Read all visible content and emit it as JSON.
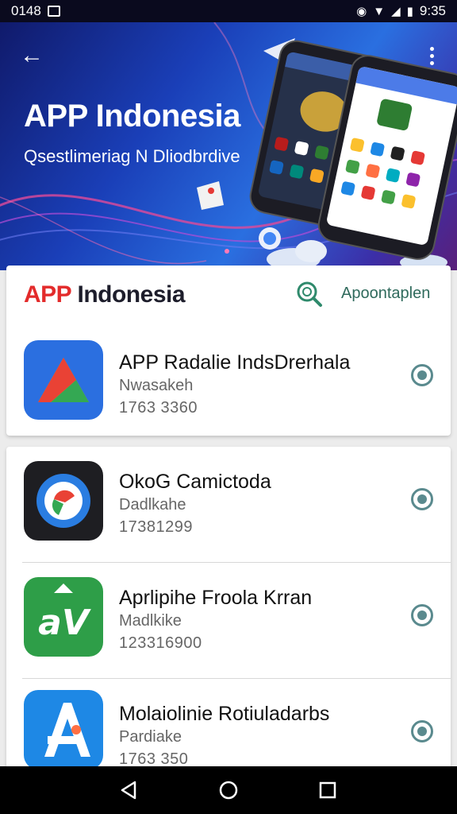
{
  "status_bar": {
    "left_time": "0148",
    "right_time": "9:35"
  },
  "hero": {
    "title": "APP Indonesia",
    "subtitle": "Qsestlimeriag N Dliodbrdive"
  },
  "header": {
    "brand_red": "APP",
    "brand_dark": "Indonesia",
    "apps_link": "Apoontaplen"
  },
  "featured_app": {
    "name": "APP Radalie IndsDrerhala",
    "subtitle": "Nwasakeh",
    "number": "1763 3360",
    "icon": "triangle-play-icon"
  },
  "apps": [
    {
      "name": "OkoG Camictoda",
      "subtitle": "Dadlkahe",
      "number": "17381299",
      "icon": "chrome-circle-icon"
    },
    {
      "name": "Aprlipihe Froola Krran",
      "subtitle": "Madlkike",
      "number": "123316900",
      "icon": "av-letters-icon"
    },
    {
      "name": "Molaiolinie Rotiuladarbs",
      "subtitle": "Pardiake",
      "number": "1763 350",
      "icon": "app-store-a-icon"
    }
  ],
  "colors": {
    "accent_teal": "#5a8a8e",
    "brand_red": "#e32b2b",
    "link_green": "#2f6a5c"
  }
}
